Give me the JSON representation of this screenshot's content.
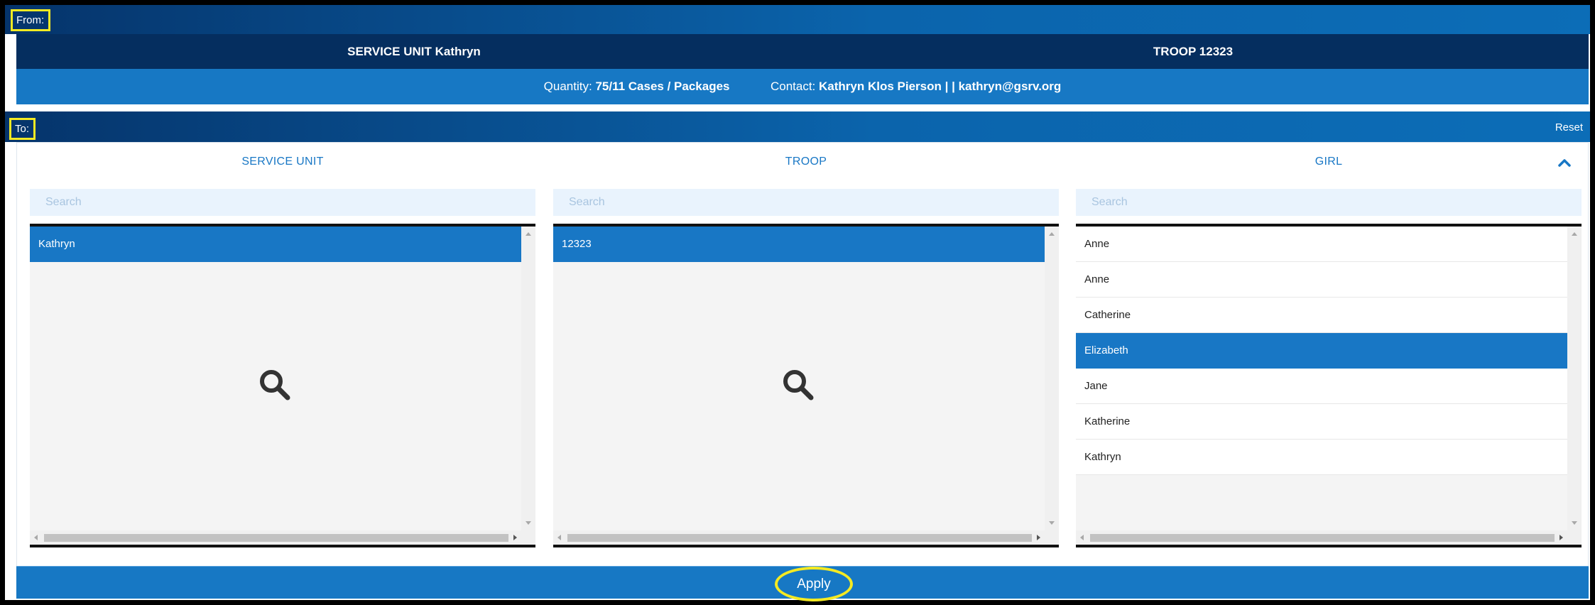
{
  "from": {
    "label": "From:",
    "service_unit": "SERVICE UNIT Kathryn",
    "troop": "TROOP 12323",
    "quantity_label": "Quantity:",
    "quantity_value": "75/11 Cases / Packages",
    "contact_label": "Contact:",
    "contact_value": "Kathryn Klos Pierson | | kathryn@gsrv.org"
  },
  "to": {
    "label": "To:",
    "reset_label": "Reset",
    "columns": [
      {
        "title": "SERVICE UNIT",
        "search_placeholder": "Search",
        "items": [
          "Kathryn"
        ],
        "selected": "Kathryn"
      },
      {
        "title": "TROOP",
        "search_placeholder": "Search",
        "items": [
          "12323"
        ],
        "selected": "12323"
      },
      {
        "title": "GIRL",
        "search_placeholder": "Search",
        "items": [
          "Anne",
          "Anne",
          "Catherine",
          "Elizabeth",
          "Jane",
          "Katherine",
          "Kathryn"
        ],
        "selected": "Elizabeth"
      }
    ]
  },
  "apply_label": "Apply",
  "icons": {
    "empty_list": "search-icon",
    "collapse": "chevron-up-icon"
  },
  "colors": {
    "primary": "#1778c4",
    "dark_navy": "#052e5f",
    "highlight_outline": "#f5ea22",
    "search_bg": "#e9f3fd"
  }
}
